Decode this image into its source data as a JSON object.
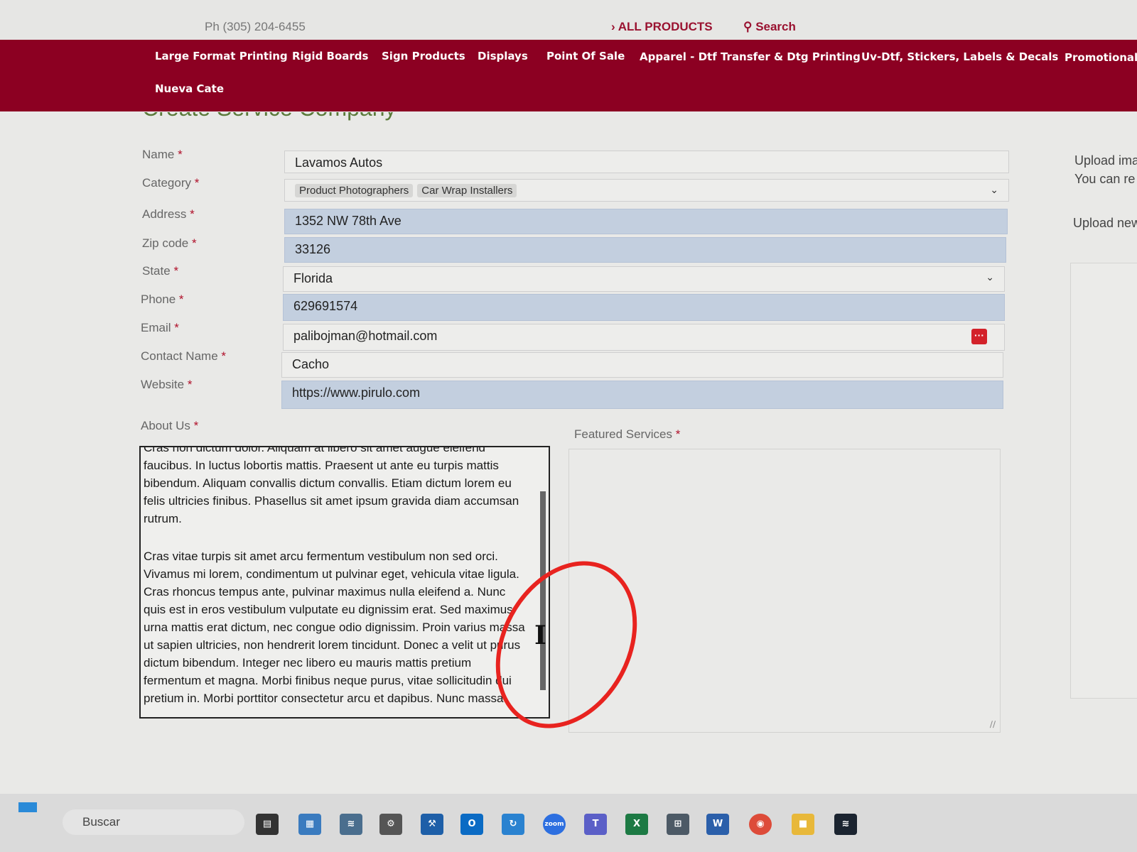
{
  "topbar": {
    "phone": "Ph (305) 204-6455",
    "all_products": "ALL PRODUCTS",
    "search": "Search"
  },
  "nav": {
    "items": [
      "Large Format Printing",
      "Rigid Boards",
      "Sign Products",
      "Displays",
      "Point Of Sale",
      "Apparel - Dtf Transfer & Dtg Printing",
      "Uv-Dtf, Stickers, Labels & Decals",
      "Promotional",
      "Nueva Cate"
    ]
  },
  "page": {
    "title": "Create Service Company"
  },
  "form": {
    "name_label": "Name",
    "name_value": "Lavamos Autos",
    "category_label": "Category",
    "category_tags": [
      "Product Photographers",
      "Car Wrap Installers"
    ],
    "address_label": "Address",
    "address_value": "1352 NW 78th Ave",
    "zip_label": "Zip code",
    "zip_value": "33126",
    "state_label": "State",
    "state_value": "Florida",
    "phone_label": "Phone",
    "phone_value": "629691574",
    "email_label": "Email",
    "email_value": "palibojman@hotmail.com",
    "contact_label": "Contact Name",
    "contact_value": "Cacho",
    "website_label": "Website",
    "website_value": "https://www.pirulo.com",
    "about_label": "About Us",
    "about_paragraph_1": "Cras non dictum dolor. Aliquam at libero sit amet augue eleifend faucibus. In luctus lobortis mattis. Praesent ut ante eu turpis mattis bibendum. Aliquam convallis dictum convallis. Etiam dictum lorem eu felis ultricies finibus. Phasellus sit amet ipsum gravida diam accumsan rutrum.",
    "about_paragraph_2": "Cras vitae turpis sit amet arcu fermentum vestibulum non sed orci. Vivamus mi lorem, condimentum ut pulvinar eget, vehicula vitae ligula. Cras rhoncus tempus ante, pulvinar maximus nulla eleifend a. Nunc quis est in eros vestibulum vulputate eu dignissim erat. Sed maximus urna mattis erat dictum, nec congue odio dignissim. Proin varius massa ut sapien ultricies, non hendrerit lorem tincidunt. Donec a velit ut purus dictum bibendum. Integer nec libero eu mauris mattis pretium fermentum et magna. Morbi finibus neque purus, vitae sollicitudin dui pretium in. Morbi porttitor consectetur arcu et dapibus. Nunc massa",
    "featured_label": "Featured Services",
    "required_mark": "*"
  },
  "side": {
    "upload_line_1": "Upload ima",
    "upload_line_2": "You can re",
    "upload_new": "Upload new"
  },
  "taskbar": {
    "search_placeholder": "Buscar",
    "icons": [
      "task-view-icon",
      "photos-icon",
      "monitor-icon",
      "settings-icon",
      "tools-icon",
      "outlook-icon",
      "sync-icon",
      "zoom-icon",
      "teams-icon",
      "excel-icon",
      "calculator-icon",
      "word-icon",
      "chrome-icon",
      "folder-icon",
      "app-icon"
    ],
    "zoom_text": "zoom"
  },
  "colors": {
    "brand": "#8c0022",
    "required": "#b0102a",
    "filled_input": "#c3cfdf",
    "annotation": "#e8231f"
  }
}
